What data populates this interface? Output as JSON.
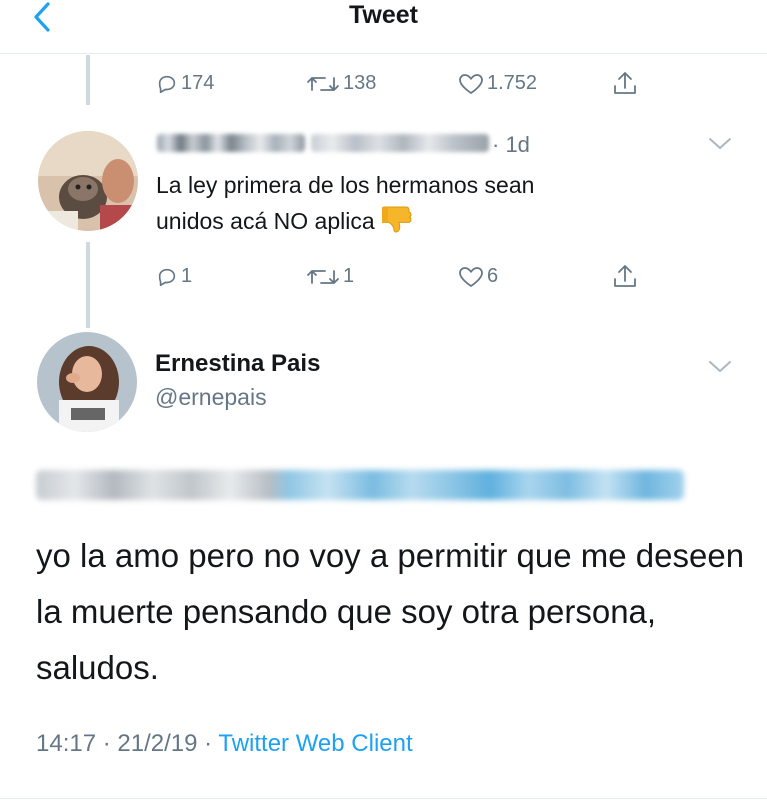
{
  "header": {
    "title": "Tweet"
  },
  "top_actions": {
    "replies": "174",
    "retweets": "138",
    "likes": "1.752"
  },
  "reply_tweet": {
    "time": "· 1d",
    "text_line1": "La ley primera de los hermanos sean",
    "text_line2": "unidos acá NO aplica",
    "emoji": "👎",
    "actions": {
      "replies": "1",
      "retweets": "1",
      "likes": "6"
    }
  },
  "main_tweet": {
    "display_name": "Ernestina Pais",
    "handle": "@ernepais",
    "text": "yo la amo pero no voy a permitir que me deseen la muerte pensando que soy otra persona, saludos.",
    "timestamp": "14:17 · 21/2/19 · ",
    "client": "Twitter Web Client"
  },
  "colors": {
    "accent": "#1da1f2",
    "muted": "#657786",
    "text": "#14171a"
  }
}
